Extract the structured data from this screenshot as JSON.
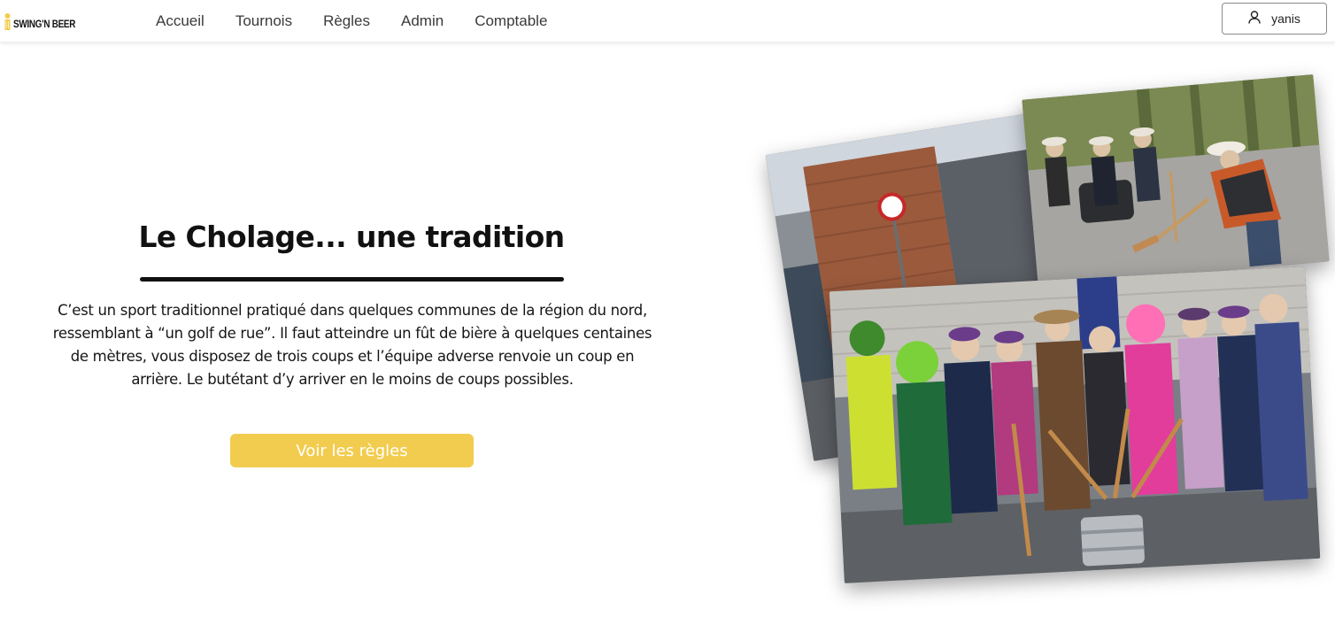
{
  "brand": {
    "name": "SWING'N BEER",
    "logo_icon": "beer-glass-icon",
    "accent": "#f2cc4e"
  },
  "nav": {
    "items": [
      {
        "label": "Accueil"
      },
      {
        "label": "Tournois"
      },
      {
        "label": "Règles"
      },
      {
        "label": "Admin"
      },
      {
        "label": "Comptable"
      }
    ]
  },
  "user": {
    "name": "yanis",
    "icon": "user-icon"
  },
  "hero": {
    "title": "Le Cholage... une tradition",
    "description": "C’est un sport traditionnel pratiqué dans quelques communes de la région du nord, ressemblant à “un golf de rue”. Il faut atteindre un fût de bière à quelques centaines de mètres, vous disposez de trois coups et l’équipe adverse renvoie un coup en arrière. Le butétant d’y arriver en le moins de coups possibles.",
    "cta_label": "Voir les règles",
    "cta_color": "#f2cc4e"
  },
  "photos": [
    {
      "name": "street-scene-photo"
    },
    {
      "name": "players-golfing-photo"
    },
    {
      "name": "costumed-group-photo"
    }
  ]
}
